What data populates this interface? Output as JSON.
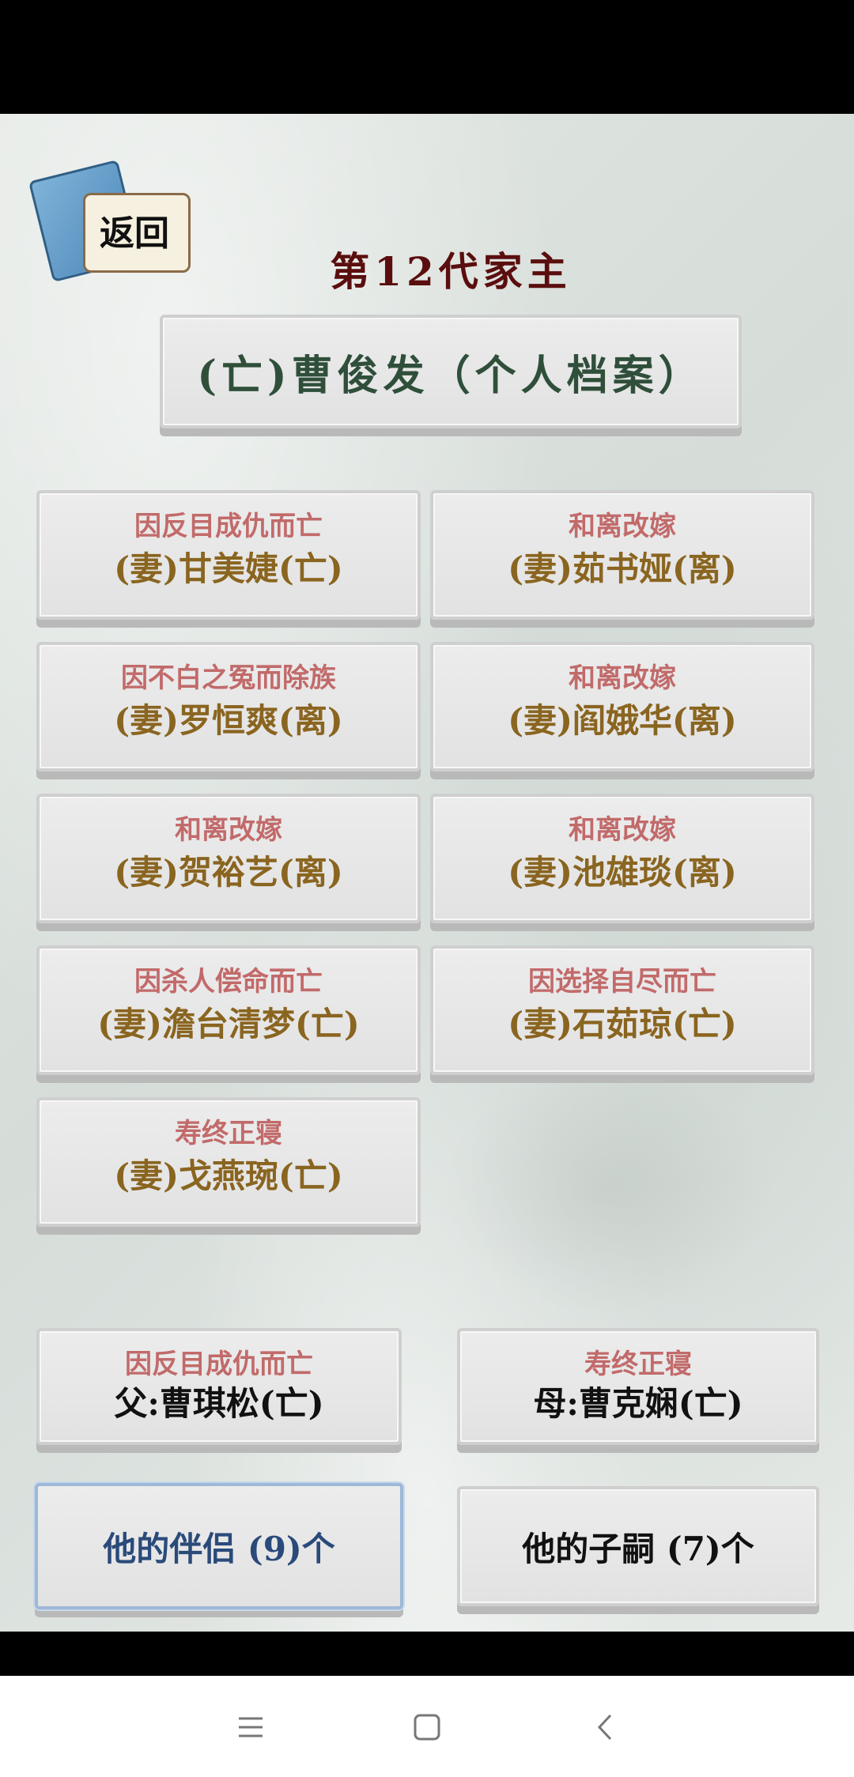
{
  "header": {
    "back_label": "返回",
    "title": "第12代家主"
  },
  "profile_button": {
    "label": "(亡)曹俊发（个人档案）"
  },
  "spouses": [
    {
      "status": "因反目成仇而亡",
      "name": "(妻)甘美婕(亡)"
    },
    {
      "status": "和离改嫁",
      "name": "(妻)茹书娅(离)"
    },
    {
      "status": "因不白之冤而除族",
      "name": "(妻)罗恒爽(离)"
    },
    {
      "status": "和离改嫁",
      "name": "(妻)阎娥华(离)"
    },
    {
      "status": "和离改嫁",
      "name": "(妻)贺裕艺(离)"
    },
    {
      "status": "和离改嫁",
      "name": "(妻)池雄琰(离)"
    },
    {
      "status": "因杀人偿命而亡",
      "name": "(妻)澹台清梦(亡)"
    },
    {
      "status": "因选择自尽而亡",
      "name": "(妻)石茹琼(亡)"
    },
    {
      "status": "寿终正寝",
      "name": "(妻)戈燕琬(亡)"
    }
  ],
  "parents": {
    "father": {
      "status": "因反目成仇而亡",
      "name": "父:曹琪松(亡)"
    },
    "mother": {
      "status": "寿终正寝",
      "name": "母:曹克娴(亡)"
    }
  },
  "tabs": {
    "partners": "他的伴侣 (9)个",
    "children": "他的子嗣 (7)个"
  },
  "icons": {
    "nav_menu": "menu-icon",
    "nav_home": "home-icon",
    "nav_back": "back-icon"
  }
}
